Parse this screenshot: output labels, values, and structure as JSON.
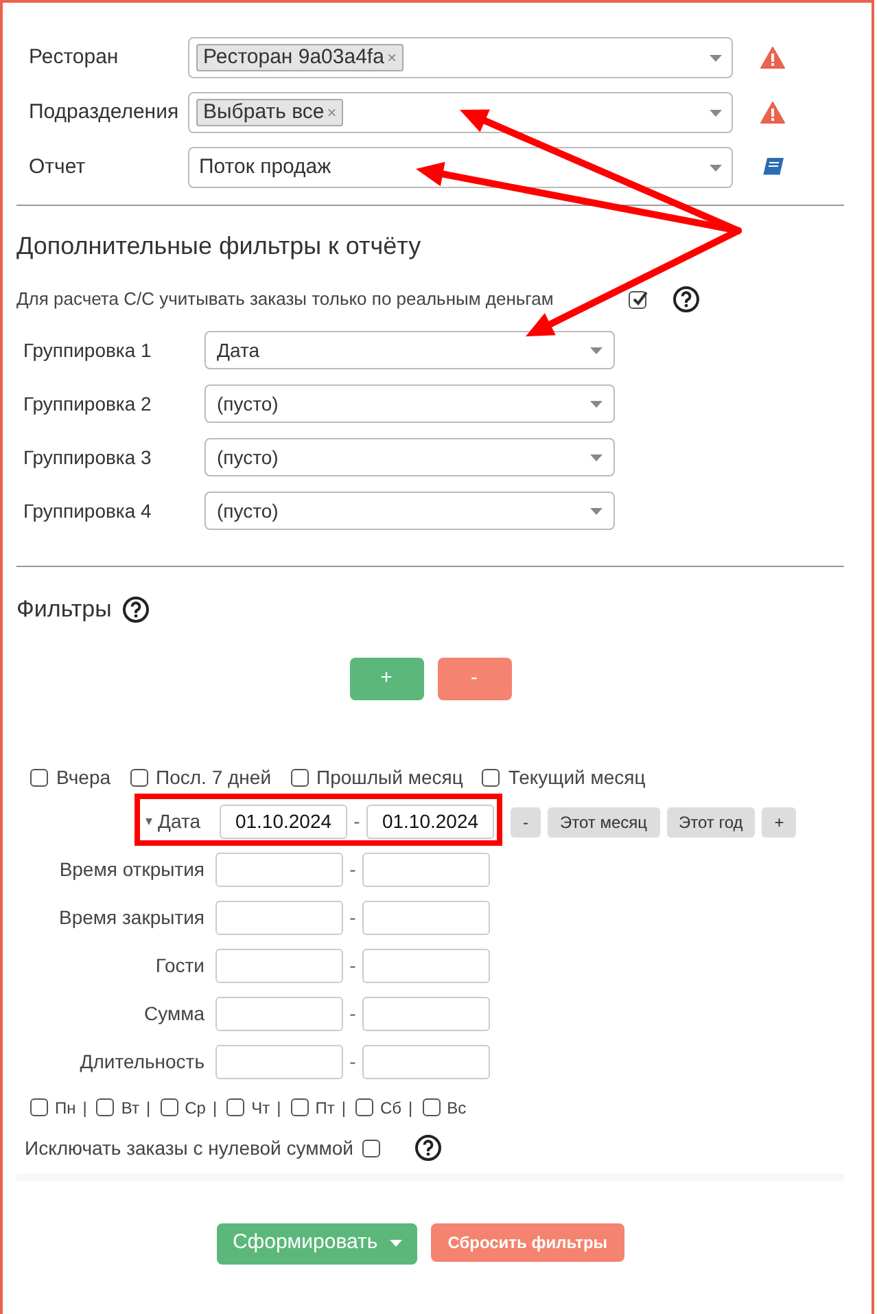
{
  "main_fields": [
    {
      "label": "Ресторан",
      "kind": "tags",
      "tags": [
        {
          "label": "Ресторан 9a03a4fa",
          "remove": "×"
        }
      ]
    },
    {
      "label": "Подразделения",
      "kind": "tags",
      "tags": [
        {
          "label": "Выбрать все",
          "remove": "×"
        }
      ]
    },
    {
      "label": "Отчет",
      "kind": "value",
      "value": "Поток продаж"
    }
  ],
  "extra_filters": {
    "title": "Дополнительные фильтры к отчёту",
    "real_money": {
      "label": "Для расчета С/С учитывать заказы только по реальным деньгам",
      "checked": true
    },
    "groupings": [
      {
        "label": "Группировка 1",
        "value": "Дата"
      },
      {
        "label": "Группировка 2",
        "value": "(пусто)"
      },
      {
        "label": "Группировка 3",
        "value": "(пусто)"
      },
      {
        "label": "Группировка 4",
        "value": "(пусто)"
      }
    ]
  },
  "filters": {
    "title": "Фильтры",
    "add_button": "+",
    "remove_button": "-",
    "quick_periods": [
      {
        "label": "Вчера",
        "checked": false
      },
      {
        "label": "Посл. 7 дней",
        "checked": false
      },
      {
        "label": "Прошлый месяц",
        "checked": false
      },
      {
        "label": "Текущий месяц",
        "checked": false
      }
    ],
    "date": {
      "label": "Дата",
      "from": "01.10.2024",
      "separator": "-",
      "to": "01.10.2024",
      "buttons": [
        "-",
        "Этот месяц",
        "Этот год",
        "+"
      ]
    },
    "ranges": [
      {
        "label": "Время открытия",
        "separator": "-"
      },
      {
        "label": "Время закрытия",
        "separator": "-"
      },
      {
        "label": "Гости",
        "separator": "-"
      },
      {
        "label": "Сумма",
        "separator": "-"
      },
      {
        "label": "Длительность",
        "separator": "-"
      }
    ],
    "weekdays": [
      {
        "label": "Пн",
        "checked": false,
        "separator": "|"
      },
      {
        "label": "Вт",
        "checked": false,
        "separator": "|"
      },
      {
        "label": "Ср",
        "checked": false,
        "separator": "|"
      },
      {
        "label": "Чт",
        "checked": false,
        "separator": "|"
      },
      {
        "label": "Пт",
        "checked": false,
        "separator": "|"
      },
      {
        "label": "Сб",
        "checked": false,
        "separator": "|"
      },
      {
        "label": "Вс",
        "checked": false
      }
    ],
    "exclude_zero": {
      "label": "Исключать заказы с нулевой суммой",
      "checked": false
    }
  },
  "actions": {
    "generate": "Сформировать",
    "reset": "Сбросить фильтры"
  },
  "annotations": [
    {
      "kind": "arrow"
    },
    {
      "kind": "arrow"
    },
    {
      "kind": "arrow"
    },
    {
      "kind": "highlight"
    }
  ]
}
